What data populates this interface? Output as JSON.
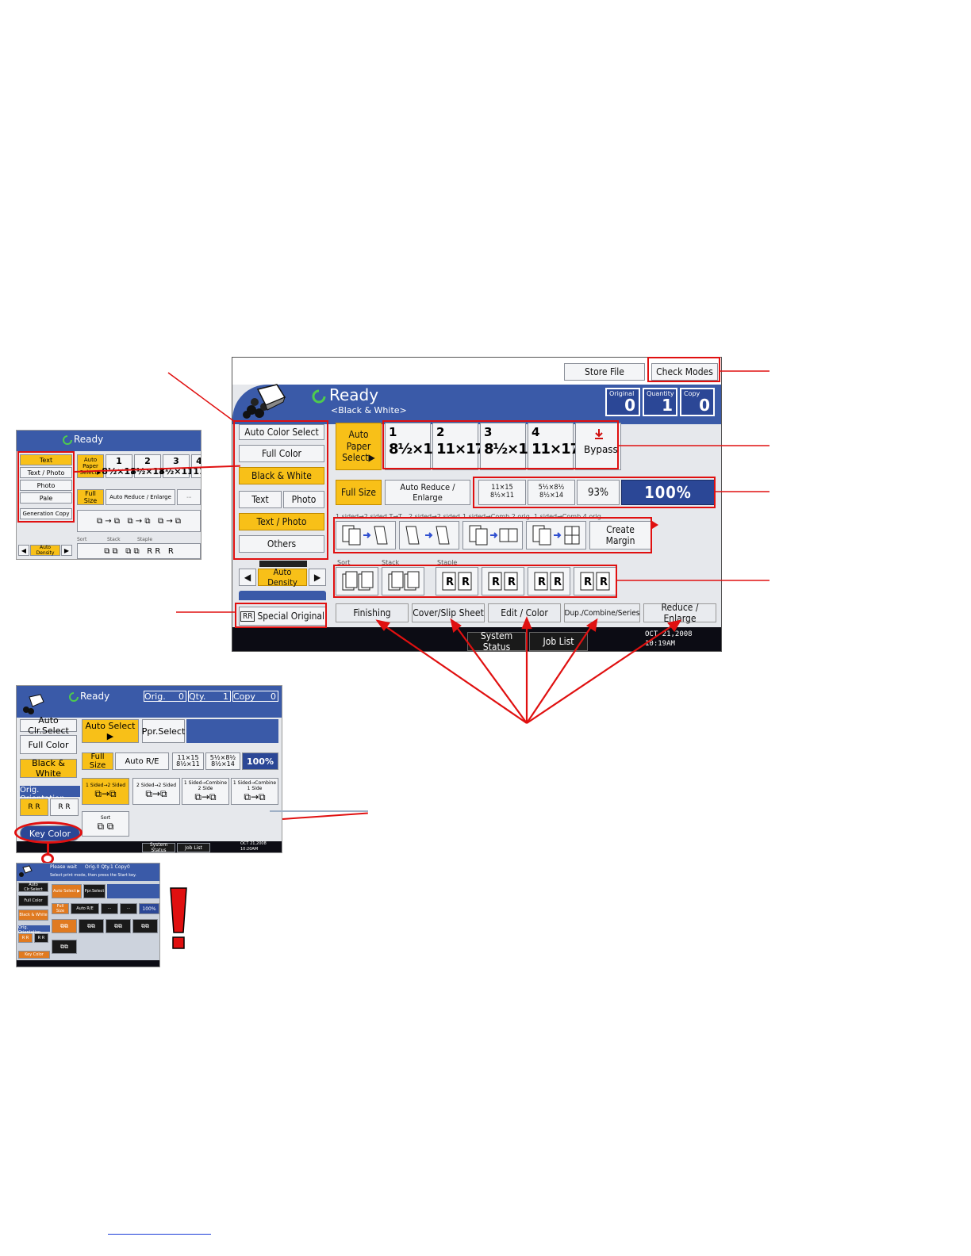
{
  "panel": {
    "top_buttons": {
      "store_file": "Store File",
      "check_modes": "Check Modes"
    },
    "status": {
      "title": "Ready",
      "subtitle": "<Black & White>"
    },
    "counters": [
      {
        "label": "Original",
        "value": "0"
      },
      {
        "label": "Quantity",
        "value": "1"
      },
      {
        "label": "Copy",
        "value": "0"
      }
    ],
    "color_modes": {
      "auto_color_select": "Auto Color Select",
      "full_color": "Full Color",
      "black_white": "Black & White",
      "text": "Text",
      "photo": "Photo",
      "text_photo": "Text / Photo",
      "others": "Others"
    },
    "auto_paper_select": "Auto Paper Select▶",
    "trays": [
      {
        "num": "1",
        "size": "8½×11"
      },
      {
        "num": "2",
        "size": "11×17"
      },
      {
        "num": "3",
        "size": "8½×11"
      },
      {
        "num": "4",
        "size": "11×17"
      }
    ],
    "bypass": "Bypass",
    "reduce_row": {
      "full_size": "Full Size",
      "auto_reduce_enlarge": "Auto Reduce / Enlarge",
      "preset1_top": "11×15",
      "preset1_bottom": "8½×11",
      "preset2_top": "5½×8½",
      "preset2_bottom": "8½×14",
      "pct93": "93%",
      "pct100": "100%"
    },
    "duplex_labels": [
      "1 sided→2 sided T→T",
      "2 sided→2 sided",
      "1 sided→Comb 2 orig",
      "1 sided→Comb 4 orig"
    ],
    "create_margin": "Create Margin",
    "density": {
      "label": "Auto Density"
    },
    "finish_labels": {
      "sort": "Sort",
      "stack": "Stack",
      "staple": "Staple"
    },
    "special_original": "Special Original",
    "tabs": [
      "Finishing",
      "Cover/Slip Sheet",
      "Edit / Color",
      "Dup./Combine/Series",
      "Reduce / Enlarge"
    ],
    "bottom": {
      "system_status": "System Status",
      "job_list": "Job List",
      "date": "OCT  21,2008",
      "time": "10:19AM"
    }
  },
  "shot1": {
    "ready": "Ready",
    "modes": [
      "Text",
      "Text / Photo",
      "Photo",
      "Pale",
      "Generation Copy"
    ],
    "auto_paper": "Auto Paper Select▶",
    "trays": [
      {
        "num": "1",
        "size": "8½×11"
      },
      {
        "num": "2",
        "size": "8½×11"
      },
      {
        "num": "3",
        "size": "8½×11"
      },
      {
        "num": "4",
        "size": "11"
      }
    ],
    "full_size": "Full Size",
    "auto_reduce": "Auto Reduce / Enlarge",
    "density": "Auto Density",
    "sort": "Sort",
    "stack": "Stack",
    "staple": "Staple"
  },
  "shot2": {
    "ready": "Ready",
    "orig": "Orig.",
    "orig_val": "0",
    "qty": "Qty.",
    "qty_val": "1",
    "copy": "Copy",
    "copy_val": "0",
    "auto_clr_select": "Auto Clr.Select",
    "full_color": "Full Color",
    "black_white": "Black & White",
    "orig_orientation": "Orig. Orientation",
    "key_color": "Key Color",
    "auto_select": "Auto Select ▶",
    "ppr_select": "Ppr.Select",
    "full_size": "Full Size",
    "auto_re": "Auto R/E",
    "preset1_top": "11×15",
    "preset1_bottom": "8½×11",
    "preset2_top": "5½×8½",
    "preset2_bottom": "8½×14",
    "pct100": "100%",
    "duplex": [
      "1 Sided→2 Sided",
      "2 Sided→2 Sided",
      "1 Sided→Combine 2 Side",
      "1 Sided→Combine 1 Side"
    ],
    "sort": "Sort",
    "system_status": "System Status",
    "job_list": "Job List",
    "date": "OCT  21,2008",
    "time": "10:20AM"
  },
  "shot3": {
    "please_wait": "Please wait",
    "orig": "Orig.",
    "orig_val": "0",
    "qty": "Qty.",
    "qty_val": "1",
    "copy": "Copy",
    "copy_val": "0",
    "message": "Select print mode, then press the Start key.",
    "auto_clr_select": "Auto Clr.Select",
    "full_color": "Full Color",
    "black_white": "Black & White",
    "orig_orientation": "Orig. Orientation",
    "key_color": "Key Color",
    "auto_select": "Auto Select ▶",
    "ppr_select": "Ppr.Select",
    "full_size": "Full Size",
    "auto_re": "Auto R/E",
    "pct100": "100%"
  },
  "colors": {
    "accent_blue": "#3a5aa8",
    "selected_yellow": "#f8c018",
    "callout_red": "#e01010"
  }
}
